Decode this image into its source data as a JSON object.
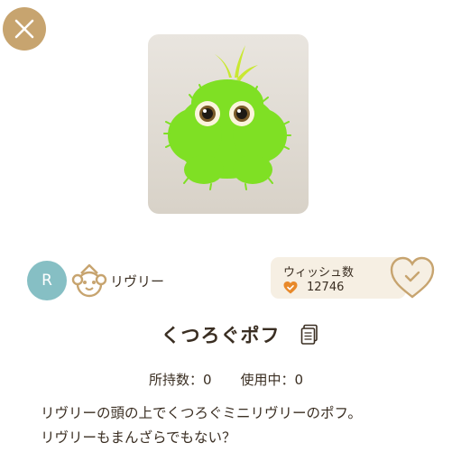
{
  "header": {
    "close_icon": "close-icon"
  },
  "item": {
    "image_alt": "くつろぐポフ",
    "title": "くつろぐポフ",
    "owned_count": "所持数：0",
    "in_use_count": "使用中：0",
    "description_line1": "リヴリーの頭の上でくつろぐミニリヴリーのポフ。",
    "description_line2": "リヴリーもまんざらでもない？"
  },
  "owner": {
    "avatar_letter": "R",
    "name": "リヴリー"
  },
  "wish": {
    "label": "ウィッシュ数",
    "count": "12746"
  },
  "colors": {
    "accent": "#c7a46f",
    "avatar": "#86bfc4",
    "wish_bg": "#f6efe3",
    "heart_orange": "#e8892a",
    "creature_green": "#7fe024"
  }
}
